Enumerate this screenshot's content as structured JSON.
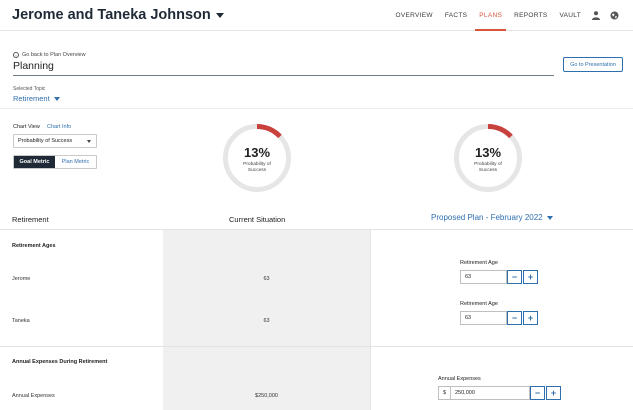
{
  "header": {
    "client_name": "Jerome and Taneka Johnson",
    "nav": [
      "OVERVIEW",
      "FACTS",
      "PLANS",
      "REPORTS",
      "VAULT"
    ],
    "active_nav": "PLANS",
    "accent_color": "#d8573c"
  },
  "page": {
    "back_link": "Go back to Plan Overview",
    "title": "Planning",
    "presentation_button": "Go to Presentation",
    "selected_topic_label": "Selected Topic",
    "selected_topic": "Retirement"
  },
  "chart_view": {
    "label": "Chart View",
    "info_link": "Chart Info",
    "selected": "Probability of Success",
    "toggle": {
      "goal": "Goal Metric",
      "plan": "Plan Metric",
      "active": "goal"
    }
  },
  "gauges": [
    {
      "percent_text": "13%",
      "value": 0.13,
      "line1": "Probability of",
      "line2": "Success"
    },
    {
      "percent_text": "13%",
      "value": 0.13,
      "line1": "Probability of",
      "line2": "Success"
    }
  ],
  "table": {
    "section_col": "Retirement",
    "current_col": "Current Situation",
    "proposed_col": "Proposed Plan - February 2022",
    "sections": {
      "retirement_ages": {
        "title": "Retirement Ages",
        "rows": [
          {
            "label": "Jerome",
            "current": "63",
            "field_label": "Retirement Age",
            "value": "63"
          },
          {
            "label": "Taneka",
            "current": "63",
            "field_label": "Retirement Age",
            "value": "63"
          }
        ]
      },
      "annual_expenses": {
        "title": "Annual Expenses During Retirement",
        "rows": [
          {
            "label": "Annual Expenses",
            "current": "$250,000",
            "field_label": "Annual Expenses",
            "currency": "$",
            "value": "250,000"
          }
        ]
      }
    }
  }
}
